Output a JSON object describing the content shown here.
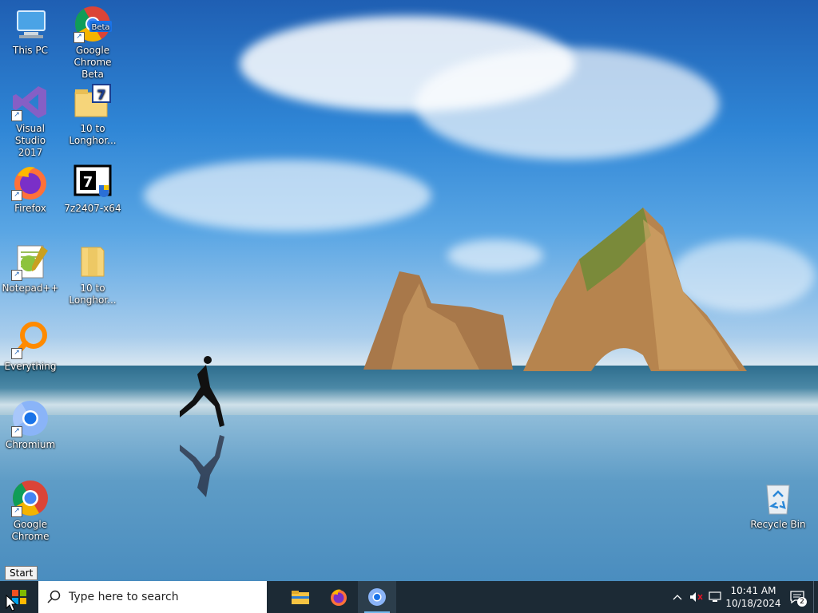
{
  "desktop": {
    "icons": [
      {
        "id": "this-pc",
        "label": "This PC"
      },
      {
        "id": "chrome-beta",
        "label": "Google\nChrome Beta",
        "badge": "Beta"
      },
      {
        "id": "visual-studio",
        "label": "Visual Studio\n2017"
      },
      {
        "id": "longhorn-1",
        "label": "10 to\nLonghor..."
      },
      {
        "id": "firefox",
        "label": "Firefox"
      },
      {
        "id": "7zip",
        "label": "7z2407-x64",
        "badge": "7"
      },
      {
        "id": "notepad",
        "label": "Notepad++"
      },
      {
        "id": "longhorn-2",
        "label": "10 to\nLonghor..."
      },
      {
        "id": "everything",
        "label": "Everything"
      },
      {
        "id": "chromium",
        "label": "Chromium"
      },
      {
        "id": "google-chrome",
        "label": "Google\nChrome"
      },
      {
        "id": "recycle-bin",
        "label": "Recycle Bin"
      }
    ]
  },
  "tooltip": {
    "start": "Start"
  },
  "taskbar": {
    "search_placeholder": "Type here to search",
    "apps": [
      "file-explorer",
      "firefox",
      "chromium"
    ],
    "clock": {
      "time": "10:41 AM",
      "date": "10/18/2024"
    },
    "notification_count": "2"
  },
  "colors": {
    "taskbar": "#1c2a35",
    "accent": "#76b9ed"
  }
}
